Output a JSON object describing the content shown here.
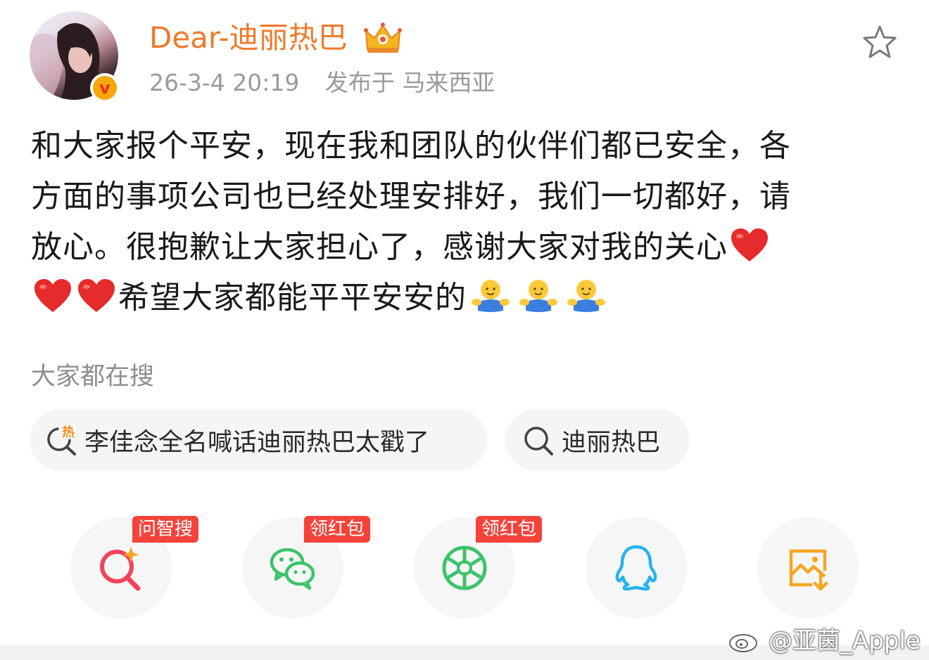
{
  "post": {
    "author": {
      "name": "Dear-迪丽热巴",
      "verified_badge": "v",
      "avatar_icon": "avatar-photo",
      "crown_icon": "vip-crown-icon"
    },
    "time": "26-3-4 20:19",
    "location": "发布于 马来西亚",
    "lines": [
      "和大家报个平安，现在我和团队的伙伴们都已安全，各",
      "方面的事项公司也已经处理安排好，我们一切都好，请",
      "放心。很抱歉让大家担心了，感谢大家对我的关心",
      "希望大家都能平平安安的"
    ]
  },
  "hot_search": {
    "heading": "大家都在搜",
    "chips": [
      {
        "label": "李佳念全名喊话迪丽热巴太戳了",
        "icon": "hot-search-icon"
      },
      {
        "label": "迪丽热巴",
        "icon": "search-icon"
      }
    ]
  },
  "share": [
    {
      "icon": "ai-search-icon",
      "badge": "问智搜",
      "color": "#f2435d"
    },
    {
      "icon": "wechat-icon",
      "badge": "领红包",
      "color": "#3cc36b"
    },
    {
      "icon": "moments-icon",
      "badge": "领红包",
      "color": "#3cc36b"
    },
    {
      "icon": "qq-icon",
      "badge": "",
      "color": "#27b3ee"
    },
    {
      "icon": "save-image-icon",
      "badge": "",
      "color": "#f5a623"
    }
  ],
  "watermark": "@亚茵_Apple",
  "colors": {
    "username": "#ee7a2b",
    "meta": "#9a9a9a",
    "badge_red": "#f4433a",
    "chip_bg": "#f5f5f5"
  }
}
